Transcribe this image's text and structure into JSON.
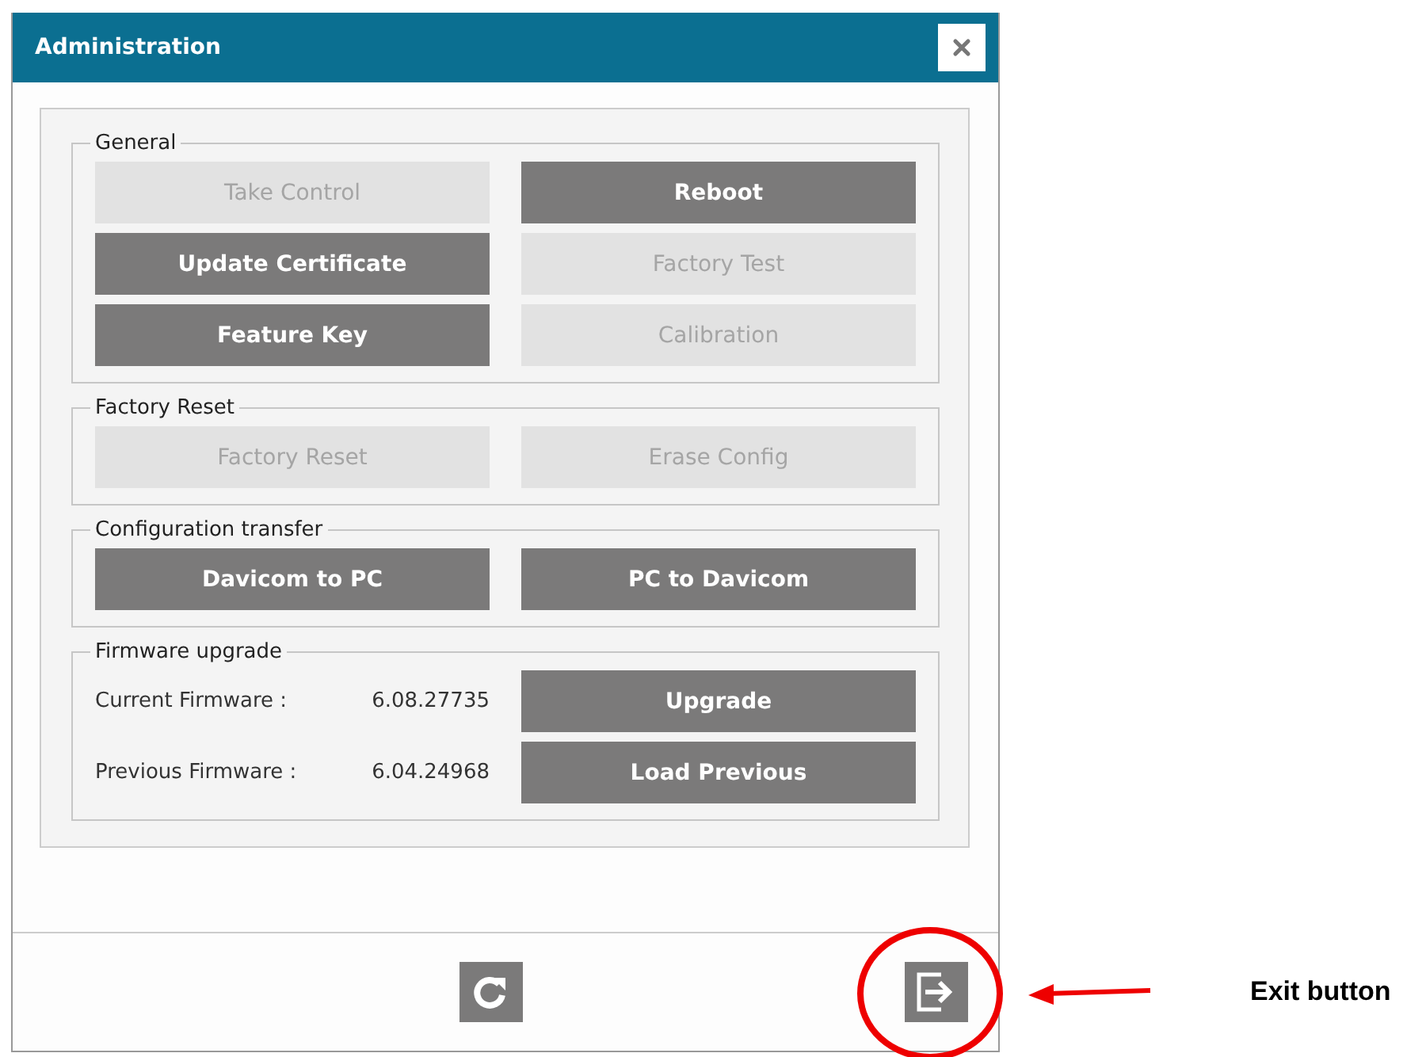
{
  "window": {
    "title": "Administration"
  },
  "sections": [
    {
      "title": "General",
      "kind": "buttons",
      "buttons": [
        {
          "label": "Take Control",
          "disabled": true
        },
        {
          "label": "Reboot",
          "disabled": false
        },
        {
          "label": "Update Certificate",
          "disabled": false
        },
        {
          "label": "Factory Test",
          "disabled": true
        },
        {
          "label": "Feature Key",
          "disabled": false
        },
        {
          "label": "Calibration",
          "disabled": true
        }
      ]
    },
    {
      "title": "Factory Reset",
      "kind": "buttons",
      "buttons": [
        {
          "label": "Factory Reset",
          "disabled": true
        },
        {
          "label": "Erase Config",
          "disabled": true
        }
      ]
    },
    {
      "title": "Configuration transfer",
      "kind": "buttons",
      "buttons": [
        {
          "label": "Davicom to PC",
          "disabled": false
        },
        {
          "label": "PC to Davicom",
          "disabled": false
        }
      ]
    },
    {
      "title": "Firmware upgrade",
      "kind": "firmware",
      "rows": [
        {
          "label": "Current Firmware :",
          "value": "6.08.27735",
          "button": {
            "label": "Upgrade",
            "disabled": false
          }
        },
        {
          "label": "Previous Firmware :",
          "value": "6.04.24968",
          "button": {
            "label": "Load Previous",
            "disabled": false
          }
        }
      ]
    }
  ],
  "annotation": {
    "label": "Exit button"
  }
}
